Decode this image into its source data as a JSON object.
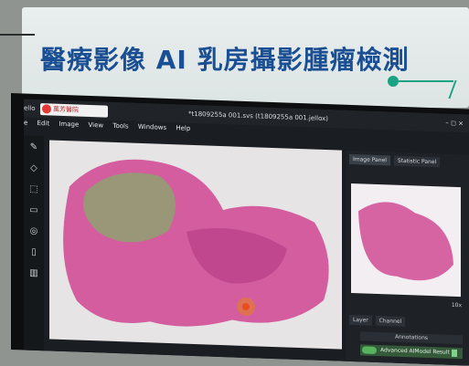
{
  "banner": {
    "title": "醫療影像 AI 乳房攝影腫瘤檢測"
  },
  "app": {
    "name": "ello",
    "logo_text": "萬芳醫院",
    "document_title": "*t1809255a 001.svs (t1809255a 001.jellox)",
    "window_controls": "–  ◻  ×"
  },
  "menu": {
    "items": [
      "e",
      "Edit",
      "Image",
      "View",
      "Tools",
      "Windows",
      "Help"
    ]
  },
  "toolbar": {
    "icons": [
      "pencil-icon",
      "eraser-icon",
      "selection-icon",
      "comment-icon",
      "search-icon",
      "document-icon",
      "trash-icon"
    ]
  },
  "side_panel": {
    "tabs": [
      "Image Panel",
      "Statistic Panel"
    ],
    "zoom_label": "10x",
    "layer_tabs": [
      "Layer",
      "Channel"
    ],
    "annotations_label": "Annotations",
    "result_label": "Advanced AIModel Result"
  },
  "colors": {
    "banner_text": "#1b4f93",
    "connector": "#1aa383",
    "tissue_pink": "#d04a94",
    "tissue_green": "#8fa172"
  }
}
